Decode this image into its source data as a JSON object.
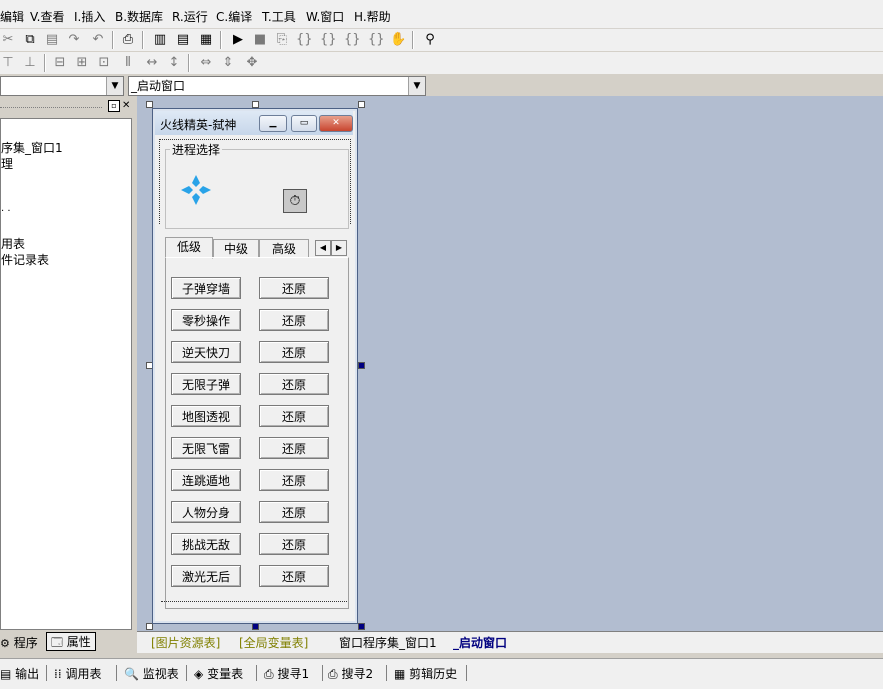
{
  "menu": [
    "编辑",
    "V.查看",
    "I.插入",
    "B.数据库",
    "R.运行",
    "C.编译",
    "T.工具",
    "W.窗口",
    "H.帮助"
  ],
  "combo_left": {
    "value": ""
  },
  "combo_right": {
    "value": "_启动窗口"
  },
  "left_panel": {
    "tree_items": [
      "序集_窗口1",
      "理",
      "",
      ". .",
      "用表",
      "件记录表"
    ],
    "tab_program": "程序",
    "tab_properties": "属性"
  },
  "form": {
    "title": "火线精英-弑神",
    "group_label": "进程选择",
    "tabs": [
      "低级",
      "中级",
      "高级"
    ],
    "rows": [
      {
        "action": "子弹穿墙",
        "restore": "还原"
      },
      {
        "action": "零秒操作",
        "restore": "还原"
      },
      {
        "action": "逆天快刀",
        "restore": "还原"
      },
      {
        "action": "无限子弹",
        "restore": "还原"
      },
      {
        "action": "地图透视",
        "restore": "还原"
      },
      {
        "action": "无限飞雷",
        "restore": "还原"
      },
      {
        "action": "连跳遁地",
        "restore": "还原"
      },
      {
        "action": "人物分身",
        "restore": "还原"
      },
      {
        "action": "挑战无敌",
        "restore": "还原"
      },
      {
        "action": "激光无后",
        "restore": "还原"
      }
    ]
  },
  "doc_tabs": [
    "[图片资源表]",
    "[全局变量表]",
    "窗口程序集_窗口1",
    "_启动窗口"
  ],
  "bottom_bar": [
    "输出",
    "调用表",
    "监视表",
    "变量表",
    "搜寻1",
    "搜寻2",
    "剪辑历史"
  ],
  "colors": {
    "design_bg": "#b2bdd0",
    "active_tab": "#000080",
    "resource_tab": "#808000"
  }
}
